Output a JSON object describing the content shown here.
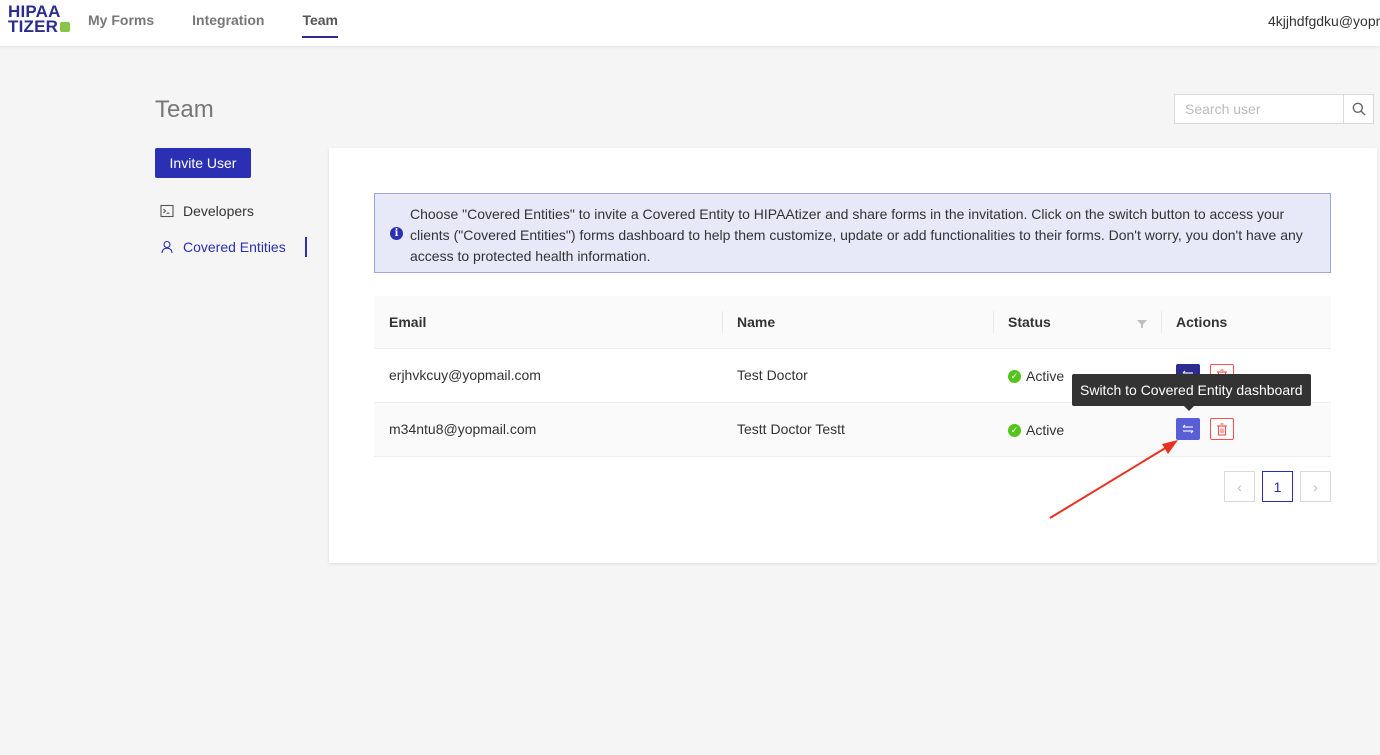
{
  "header": {
    "logo_line1": "HIPAA",
    "logo_line2": "TIZER",
    "nav": [
      {
        "label": "My Forms"
      },
      {
        "label": "Integration"
      },
      {
        "label": "Team"
      }
    ],
    "active_nav": "Team",
    "user_email": "4kjjhdfgdku@yopr"
  },
  "page": {
    "title": "Team",
    "invite_button": "Invite User",
    "search_placeholder": "Search user"
  },
  "sidebar": {
    "items": [
      {
        "label": "Developers",
        "icon": "terminal-icon"
      },
      {
        "label": "Covered Entities",
        "icon": "user-icon"
      }
    ],
    "active": "Covered Entities"
  },
  "info": {
    "icon": "info-icon",
    "text": "Choose \"Covered Entities\" to invite a Covered Entity to HIPAAtizer and share forms in the invitation. Click on the switch button to access your clients (\"Covered Entities\") forms dashboard to help them customize, update or add functionalities to their forms. Don't worry, you don't have any access to protected health information."
  },
  "table": {
    "columns": [
      "Email",
      "Name",
      "Status",
      "Actions"
    ],
    "rows": [
      {
        "email": "erjhvkcuy@yopmail.com",
        "name": "Test Doctor",
        "status": "Active"
      },
      {
        "email": "m34ntu8@yopmail.com",
        "name": "Testt Doctor Testt",
        "status": "Active"
      }
    ]
  },
  "pagination": {
    "current_page": "1",
    "prev": "‹",
    "next": "›"
  },
  "tooltip": {
    "text": "Switch to Covered Entity dashboard"
  },
  "colors": {
    "primary": "#2b2fb3",
    "status_active": "#52c41a",
    "delete": "#ff4d4f",
    "annotation_arrow": "#e8321f"
  }
}
